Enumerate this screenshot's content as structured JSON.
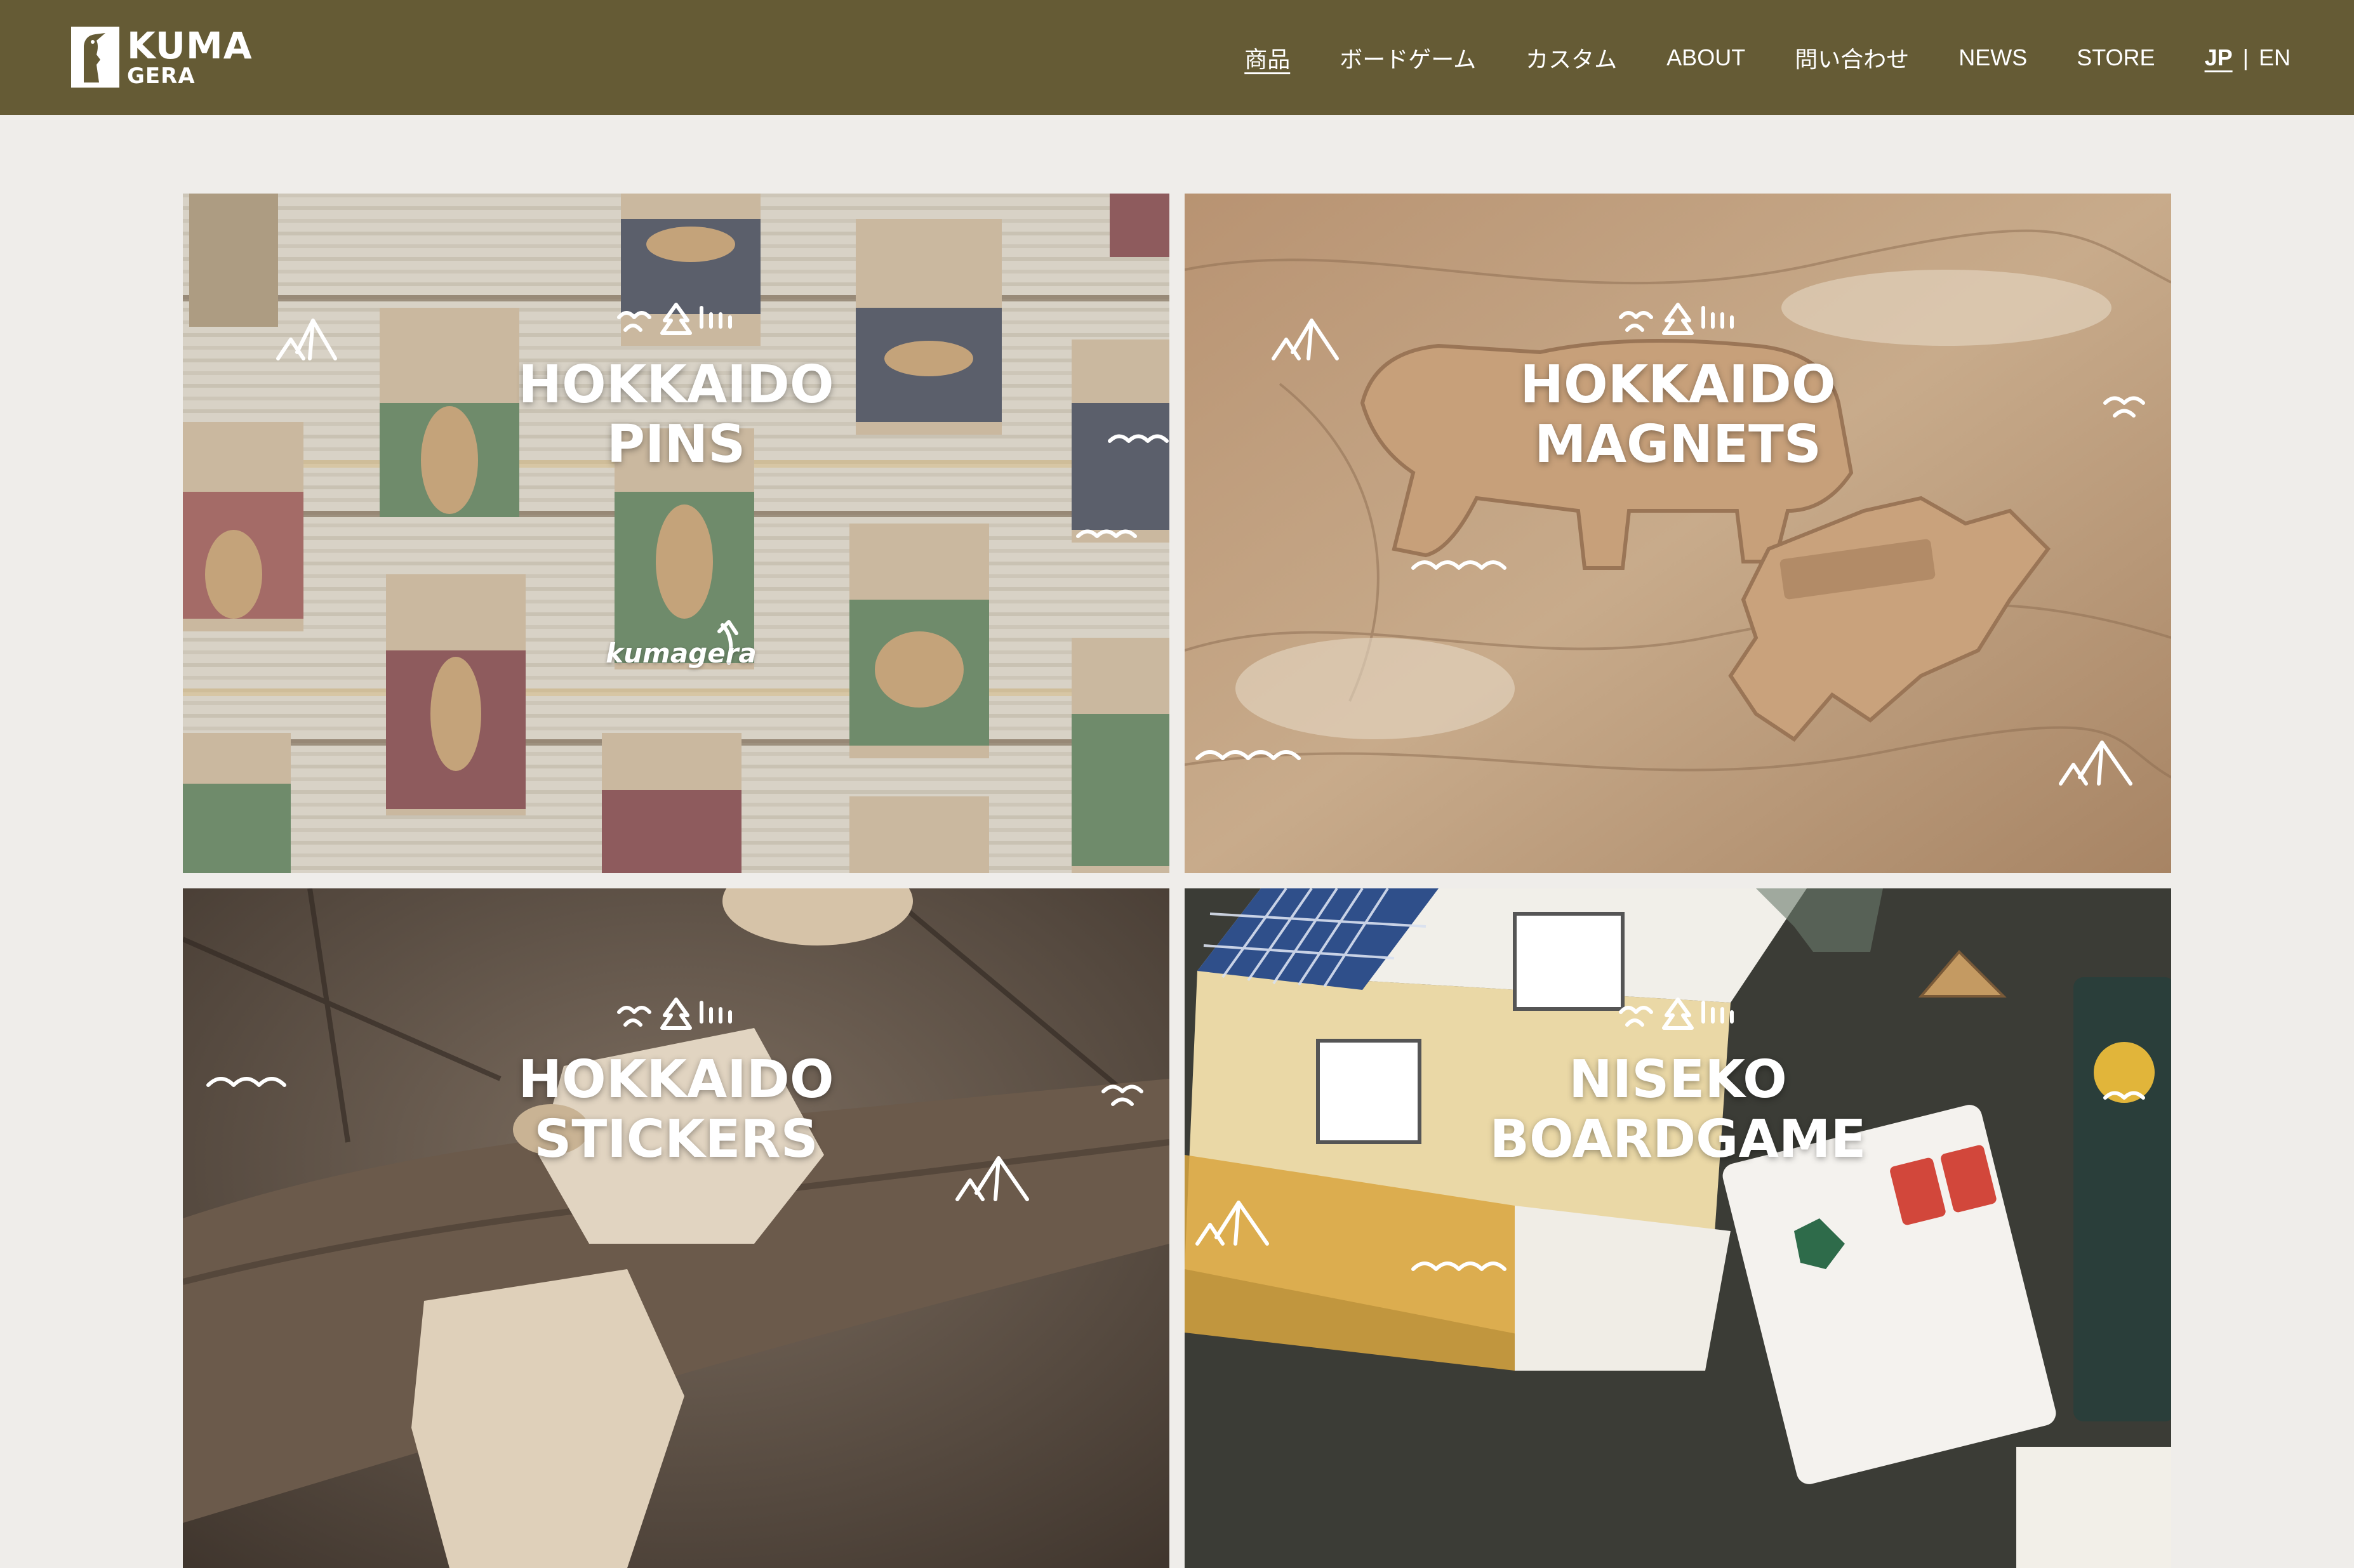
{
  "brand": {
    "logo_line1": "KUMA",
    "logo_line2": "GERA"
  },
  "nav": {
    "items": [
      "商品",
      "ボードゲーム",
      "カスタム",
      "ABOUT",
      "問い合わせ",
      "NEWS",
      "STORE"
    ],
    "active_index": 0,
    "lang_jp": "JP",
    "lang_sep": "|",
    "lang_en": "EN"
  },
  "colors": {
    "header_bg": "#655b35",
    "page_bg": "#efedea"
  },
  "tiles": [
    {
      "line1": "HOKKAIDO",
      "line2": "PINS",
      "signature": "kumagera"
    },
    {
      "line1": "HOKKAIDO",
      "line2": "MAGNETS"
    },
    {
      "line1": "HOKKAIDO",
      "line2": "STICKERS"
    },
    {
      "line1": "NISEKO",
      "line2": "BOARDGAME"
    }
  ]
}
